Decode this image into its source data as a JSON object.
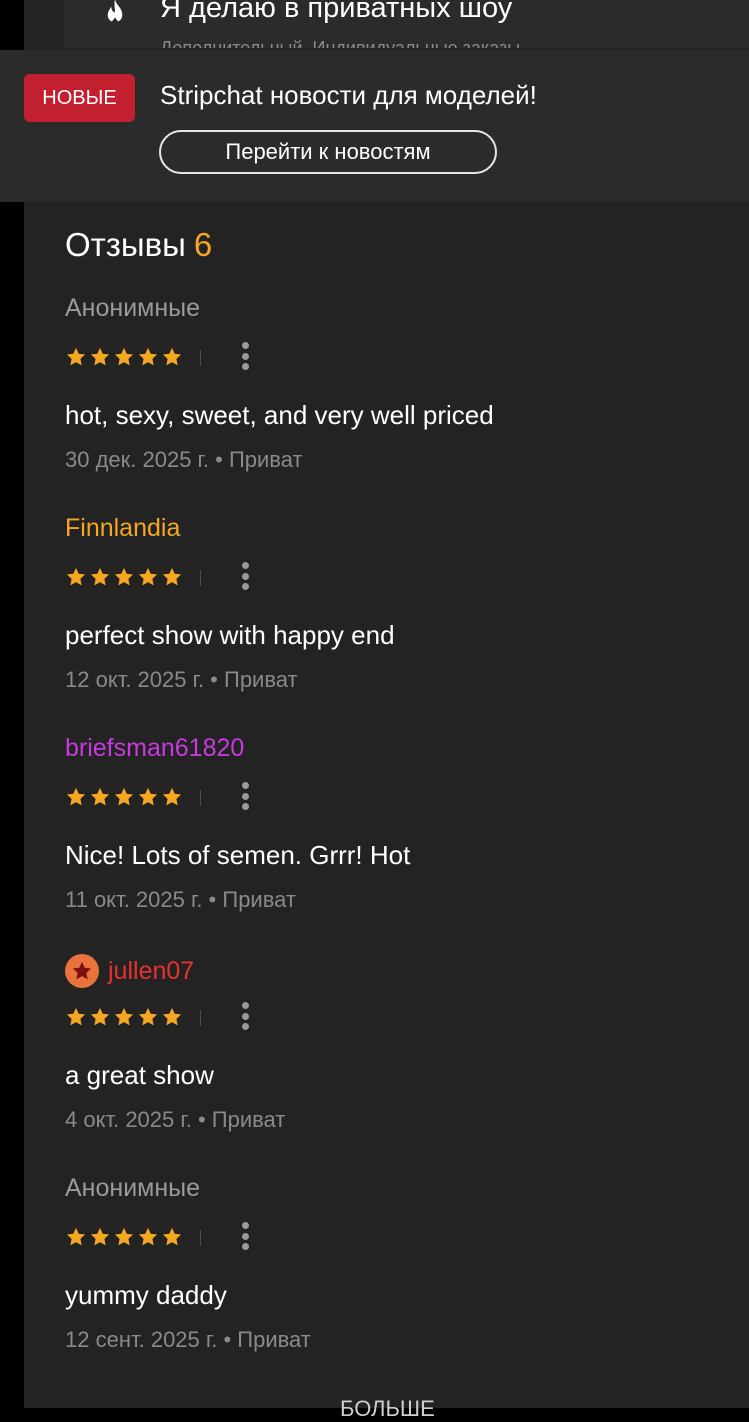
{
  "top_card": {
    "title": "Я делаю в приватных шоу",
    "subtitle": "Дополнительный. Индивидуальные заказы",
    "icon": "fire-icon"
  },
  "news": {
    "badge": "НОВЫЕ",
    "title": "Stripchat новости для моделей!",
    "button": "Перейти к новостям",
    "badge_color": "#c3202f"
  },
  "reviews": {
    "title": "Отзывы",
    "count": "6",
    "count_color": "#f5a623",
    "items": [
      {
        "author": "Анонимные",
        "author_color": "#9a9a9a",
        "rating": 5,
        "text": "hot, sexy, sweet, and very well priced",
        "date": "30 дек. 2025 г.",
        "type": "Приват"
      },
      {
        "author": "Finnlandia",
        "author_color": "#f5a623",
        "rating": 5,
        "text": "perfect show with happy end",
        "date": "12 окт. 2025 г.",
        "type": "Приват"
      },
      {
        "author": "briefsman61820",
        "author_color": "#c73adf",
        "rating": 5,
        "text": "Nice! Lots of semen. Grrr! Hot",
        "date": "11 окт. 2025 г.",
        "type": "Приват"
      },
      {
        "author": "jullen07",
        "author_color": "#e8312f",
        "has_badge": true,
        "rating": 5,
        "text": "a great show",
        "date": "4 окт. 2025 г.",
        "type": "Приват"
      },
      {
        "author": "Анонимные",
        "author_color": "#9a9a9a",
        "rating": 5,
        "text": "yummy daddy",
        "date": "12 сент. 2025 г.",
        "type": "Приват"
      }
    ]
  },
  "show_more": "БОЛЬШЕ"
}
